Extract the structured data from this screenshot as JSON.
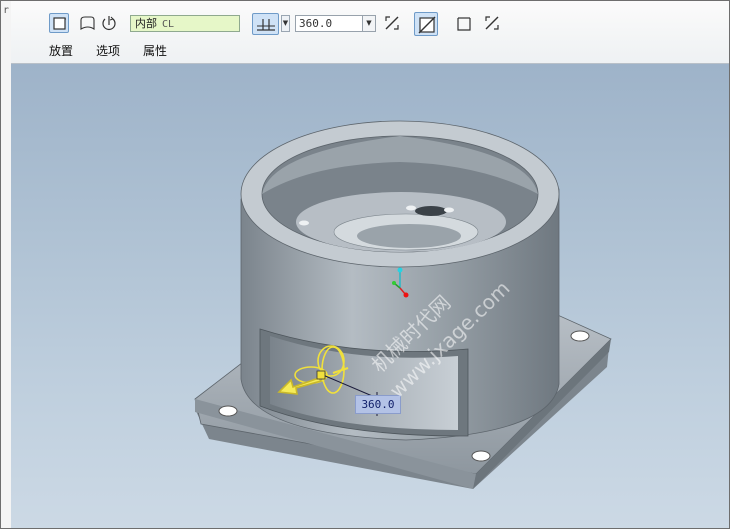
{
  "left_mark": "r",
  "toolbar": {
    "buttons": [
      {
        "name": "solid-icon",
        "active": true
      },
      {
        "name": "surface-icon",
        "active": false
      },
      {
        "name": "flip-direction-icon",
        "active": false
      }
    ],
    "reference_field": {
      "label": "内部",
      "tag": "CL"
    },
    "angle_option_icon": "angle-from-sketch-icon",
    "angle_value": "360.0",
    "icons_right": [
      "flip-angle-icon",
      "remove-material-icon",
      "thicken-icon",
      "flip-thicken-icon"
    ]
  },
  "tabs": [
    {
      "label": "放置"
    },
    {
      "label": "选项"
    },
    {
      "label": "属性"
    }
  ],
  "viewport": {
    "dimension_label": "360.0",
    "watermark_cn": "机械时代网",
    "watermark_url": "www.jxage.com"
  },
  "colors": {
    "dashboard_bg": "#f3f5f7",
    "viewport_top": "#9eb3c9",
    "viewport_bottom": "#ccd9e5",
    "model_gray": "#9aa3aa",
    "preview_yellow": "#f0e03c",
    "dim_label_bg": "#b3c2e6"
  }
}
